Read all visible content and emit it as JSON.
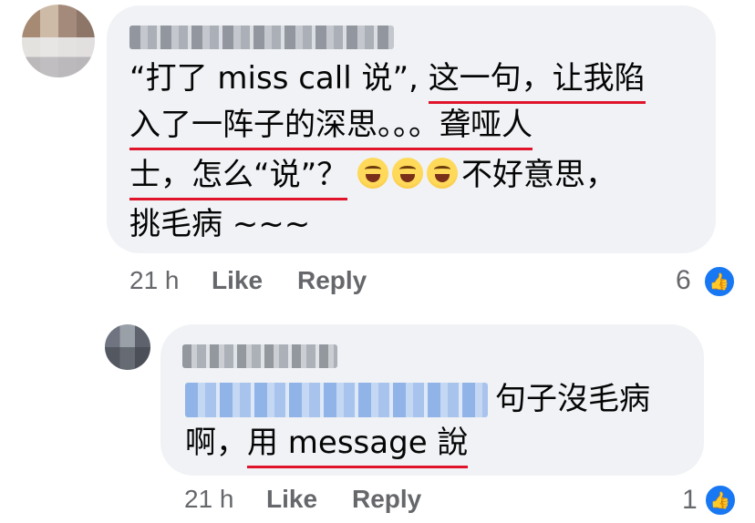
{
  "comment": {
    "lines": [
      [
        "“打了 miss call 说”, ",
        "这一句，让我陷"
      ],
      [
        "入了一阵子的深思。。。聋哑人"
      ],
      [
        "士，怎么“说”？",
        "不好意思，"
      ],
      [
        "挑毛病 ~~~"
      ]
    ],
    "time": "21 h",
    "like_label": "Like",
    "reply_label": "Reply",
    "reaction_count": "6"
  },
  "reply": {
    "text_after_mention": "句子沒毛病",
    "line2_prefix": "啊，",
    "line2_underlined": "用 message 說",
    "time": "21 h",
    "like_label": "Like",
    "reply_label": "Reply",
    "reaction_count": "1"
  },
  "colors": {
    "bubble": "#f0f2f5",
    "meta_text": "#65676b",
    "underline": "#e0142a",
    "like_blue": "#1877f2"
  },
  "icons": {
    "reaction": "thumbs-up-icon",
    "emoji": "tears-of-joy-emoji-icon"
  }
}
